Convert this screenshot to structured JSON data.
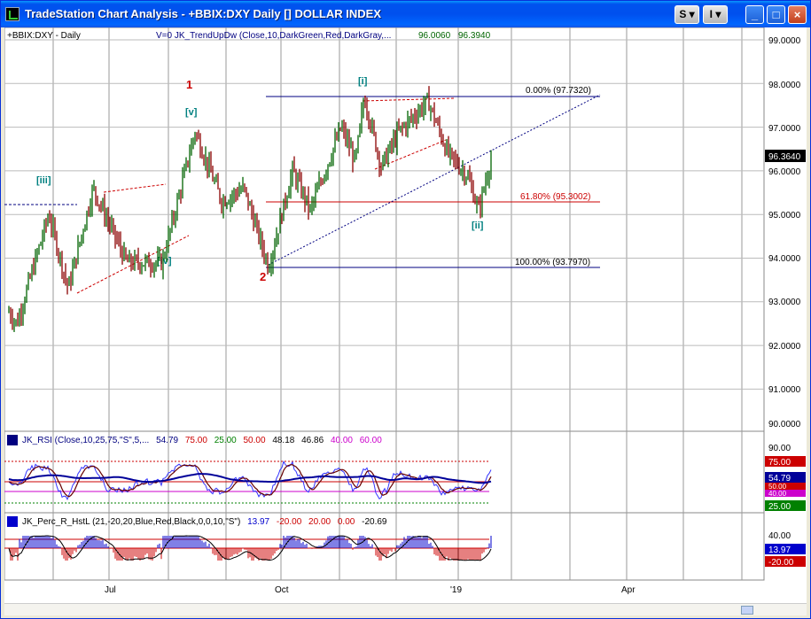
{
  "window": {
    "title": "TradeStation Chart Analysis - +BBIX:DXY Daily [] DOLLAR INDEX",
    "buttons": {
      "s": "S",
      "i": "I"
    }
  },
  "price_pane": {
    "symbol_label": "+BBIX:DXY - Daily",
    "indicator_label": "V=0  JK_TrendUpDw (Close,10,DarkGreen,Red,DarkGray,...",
    "indicator_val1": "96.0060",
    "indicator_val2": "96.3940",
    "last_price": "96.3640",
    "axis_ticks": [
      "99.0000",
      "98.0000",
      "97.0000",
      "96.0000",
      "95.0000",
      "94.0000",
      "93.0000",
      "92.0000",
      "91.0000",
      "90.0000"
    ],
    "wave_labels": {
      "w1": "1",
      "w2": "2",
      "wiii": "[iii]",
      "wiv": "[iv]",
      "wv": "[v]",
      "wi": "[i]",
      "wii": "[ii]"
    },
    "fib_labels": {
      "f0": "0.00% (97.7320)",
      "f618": "61.80% (95.3002)",
      "f100": "100.00% (93.7970)"
    }
  },
  "rsi_pane": {
    "name": "JK_RSI (Close,10,25,75,\"S\",5,...",
    "v1": "54.79",
    "v2": "75.00",
    "v3": "25.00",
    "v4": "50.00",
    "v5": "48.18",
    "v6": "46.86",
    "v7": "40.00",
    "v8": "60.00",
    "axis_top": "90.00",
    "badge_75": "75.00",
    "badge_5479": "54.79",
    "badge_50": "50.00",
    "badge_40": "40.00",
    "badge_25": "25.00"
  },
  "perc_pane": {
    "name": "JK_Perc_R_HstL (21,-20,20,Blue,Red,Black,0,0,10,\"S\")",
    "v1": "13.97",
    "v2": "-20.00",
    "v3": "20.00",
    "v4": "0.00",
    "v5": "-20.69",
    "axis_top": "40.00",
    "badge_1397": "13.97",
    "badge_m20": "-20.00"
  },
  "time_axis": {
    "labels": [
      "Jul",
      "Oct",
      "'19",
      "Apr"
    ]
  },
  "colors": {
    "up": "#006400",
    "down": "#8B0000",
    "red_label": "#CC0000",
    "teal_label": "#008080",
    "rsi_blue": "#000099",
    "perc_blue": "#0000CC"
  }
}
